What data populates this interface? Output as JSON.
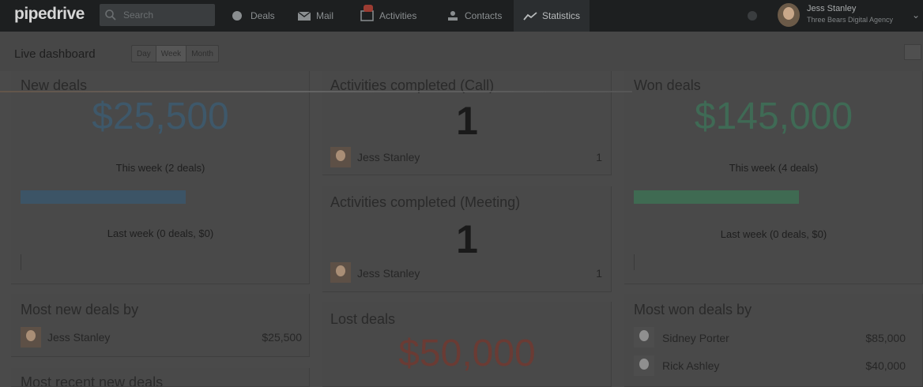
{
  "app": {
    "logo": "pipedrive",
    "search_placeholder": "Search",
    "nav": [
      {
        "label": "Deals",
        "icon": "dollar-circle-icon"
      },
      {
        "label": "Mail",
        "icon": "envelope-icon"
      },
      {
        "label": "Activities",
        "icon": "calendar-icon"
      },
      {
        "label": "Contacts",
        "icon": "person-icon"
      },
      {
        "label": "Statistics",
        "icon": "trend-line-icon"
      }
    ],
    "user": {
      "name": "Jess Stanley",
      "org": "Three Bears Digital Agency"
    }
  },
  "dashboard": {
    "title": "Live dashboard",
    "range_options": [
      "Day",
      "Week",
      "Month"
    ],
    "range_selected": "Week"
  },
  "cards": {
    "new_deals": {
      "title": "New deals",
      "amount": "$25,500",
      "this_week": "This week (2 deals)",
      "last_week": "Last week (0 deals, $0)",
      "progress": 0.59
    },
    "activities_call": {
      "title": "Activities completed (Call)",
      "count": "1",
      "user": "Jess Stanley",
      "user_count": "1"
    },
    "activities_meeting": {
      "title": "Activities completed (Meeting)",
      "count": "1",
      "user": "Jess Stanley",
      "user_count": "1"
    },
    "won_deals": {
      "title": "Won deals",
      "amount": "$145,000",
      "this_week": "This week (4 deals)",
      "last_week": "Last week (0 deals, $0)",
      "progress": 0.59
    },
    "most_new_deals": {
      "title": "Most new deals by",
      "rows": [
        {
          "name": "Jess Stanley",
          "value": "$25,500"
        }
      ]
    },
    "lost_deals": {
      "title": "Lost deals",
      "amount": "$50,000"
    },
    "most_won_deals": {
      "title": "Most won deals by",
      "rows": [
        {
          "name": "Sidney Porter",
          "value": "$85,000"
        },
        {
          "name": "Rick Ashley",
          "value": "$40,000"
        }
      ]
    },
    "most_recent_new_deals": {
      "title": "Most recent new deals"
    }
  },
  "colors": {
    "topbar": "#1d1f20",
    "blue_metric": "#3e586a",
    "green_metric": "#3f6a55",
    "red_metric": "#6a3b34"
  }
}
